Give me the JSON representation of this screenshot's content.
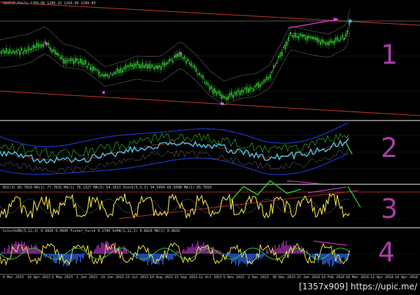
{
  "window": {
    "symbol_header": "XAUUSD,Daily  1266.06 1286.32 1264.90 1290.80"
  },
  "panes": [
    {
      "id": "price",
      "header": "XAUUSD,Daily  1266.06 1286.32 1264.90 1290.80",
      "annotation_number": "1",
      "colors": {
        "candles": "#2ecc2e",
        "trend": "#c0392b",
        "arrow": "#e040e0",
        "marker": "#5dade2"
      }
    },
    {
      "id": "bands",
      "header": "",
      "annotation_number": "2",
      "colors": {
        "main": "#48c9e8",
        "bands": "#2233cc",
        "signal": "#2ecc2e",
        "arrow": "#e040e0"
      }
    },
    {
      "id": "rsi",
      "header": "RSI(3) 85.7810    MA(1) 77.7631    MA(1) 70.1327    MA(3) 54.1631    Stoch(5,3,3) 94.5094 69.5098    MA(1) 85.7810",
      "annotation_number": "3",
      "colors": {
        "main": "#f1e24b",
        "trend": "#c0392b",
        "zigzag": "#2ecc2e",
        "arrow": "#e040e0"
      }
    },
    {
      "id": "color_osma",
      "header": "ColorOsMA(5,12,3) 0.6826 0.0000    Fisher_Yurik 0.1706    OsMA(1,12,3) 0.8826    MA(1) 0.8826",
      "annotation_number": "4",
      "colors": {
        "main": "#f1e24b",
        "hist_up": "#9b2fa8",
        "hist_down": "#2b5fd9",
        "signal": "#2ecc2e",
        "arrow": "#e040e0"
      }
    }
  ],
  "date_axis": [
    "4 Mar 2015",
    "16 Apr 2015",
    "5 May 2015",
    "1 Jun 2015",
    "29 Jun 2015",
    "23 Jul 2015",
    "19 Aug 2015",
    "15 Sep 2015",
    "12 Oct 2015",
    "5 Nov 2015",
    "2 Dec 2015",
    "30 Dec 2015",
    "25 Jan 2016",
    "19 Feb 2016",
    "16 Mar 2016",
    "12 Apr 2016",
    "14 Apr 2016"
  ],
  "watermark": "[1357x909] https://upic.me/"
}
